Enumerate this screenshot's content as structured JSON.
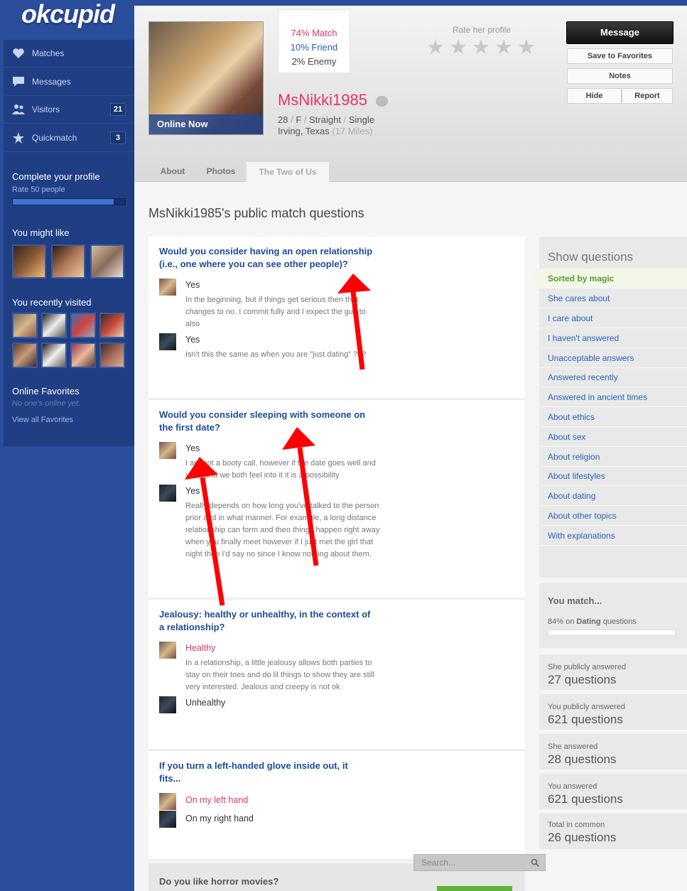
{
  "brand": {
    "logo": "okcupid"
  },
  "sidebar": {
    "nav": [
      {
        "label": "Matches",
        "count": ""
      },
      {
        "label": "Messages",
        "count": ""
      },
      {
        "label": "Visitors",
        "count": "21"
      },
      {
        "label": "Quickmatch",
        "count": "3"
      }
    ],
    "complete_profile": {
      "title": "Complete your profile",
      "subtitle": "Rate 50 people",
      "progress": 0.9
    },
    "you_might_like": "You might like",
    "recently_visited": "You recently visited",
    "online_favorites": {
      "title": "Online Favorites",
      "empty": "No one's online yet.",
      "view_all": "View all Favorites"
    }
  },
  "profile": {
    "online_status": "Online Now",
    "match": "74% Match",
    "friend": "10% Friend",
    "enemy": "2% Enemy",
    "username": "MsNikki1985",
    "age": "28",
    "gender": "F",
    "orientation": "Straight",
    "status": "Single",
    "location": "Irving, Texas",
    "distance": "(17 Miles)",
    "rate_label": "Rate her profile",
    "rating": 0,
    "actions": {
      "message": "Message",
      "favorite": "Save to Favorites",
      "notes": "Notes",
      "hide": "Hide",
      "report": "Report"
    },
    "tabs": [
      "About",
      "Photos",
      "The Two of Us"
    ]
  },
  "questions_title": "MsNikki1985's public match questions",
  "questions": [
    {
      "text_lines": [
        "Would you consider having an open relationship",
        "(i.e., one where you can see other people)?"
      ],
      "her_answer": "Yes",
      "her_explanation": [
        "In the beginning, but if things get serious then that",
        "changes to no. I commit fully and I expect the guy to",
        "also"
      ],
      "my_answer": "Yes",
      "my_explanation": [
        "Isn't this the same as when you are \"just dating\" ???"
      ]
    },
    {
      "text_lines": [
        "Would you consider sleeping with someone on",
        "the first date?"
      ],
      "her_answer": "Yes",
      "her_explanation": [
        "I am not a booty call, however if the date goes well and",
        "yeah and we both feel into it it is a possibility"
      ],
      "my_answer": "Yes",
      "my_explanation": [
        "Really depends on how long you've talked to the person",
        "prior and in what manner. For example, a long distance",
        "relationship can form and then things happen right away",
        "when you finally meet however if I just met the girl that",
        "night then I'd say no since I know nothing about them."
      ]
    },
    {
      "text_lines": [
        "Jealousy: healthy or unhealthy, in the context of",
        "a relationship?"
      ],
      "her_answer": "Healthy",
      "her_explanation": [
        "In a relationship, a little jealousy allows both parties to",
        "stay on their toes and do lil things to show they are still",
        "very interested. Jealous and creepy is not ok"
      ],
      "my_answer": "Unhealthy",
      "my_explanation": []
    },
    {
      "text_lines": [
        "If you turn a left-handed glove inside out, it",
        "fits..."
      ],
      "her_answer": "On my left hand",
      "her_explanation": [],
      "my_answer": "On my right hand",
      "my_explanation": []
    },
    {
      "text_lines": [
        "Do you like horror movies?"
      ]
    }
  ],
  "filters": {
    "title": "Show questions",
    "items": [
      "Sorted by magic",
      "She cares about",
      "I care about",
      "I haven't answered",
      "Unacceptable answers",
      "Answered recently",
      "Answered in ancient times",
      "About ethics",
      "About sex",
      "About religion",
      "About lifestyles",
      "About dating",
      "About other topics",
      "With explanations"
    ]
  },
  "you_match": {
    "title": "You match...",
    "pct": "84%",
    "on": "on",
    "category": "Dating",
    "suffix": "questions",
    "value": 0.84
  },
  "stats": [
    {
      "label": "She publicly answered",
      "value": "27 questions"
    },
    {
      "label": "You publicly answered",
      "value": "621 questions"
    },
    {
      "label": "She answered",
      "value": "28 questions"
    },
    {
      "label": "You answered",
      "value": "621 questions"
    },
    {
      "label": "Total in common",
      "value": "26 questions"
    }
  ],
  "search": {
    "placeholder": "Search..."
  },
  "colors": {
    "brand_blue": "#2b4e9c",
    "match_pink": "#e5336d",
    "link_blue": "#2a62b5",
    "annotation_red": "#ff0000"
  }
}
